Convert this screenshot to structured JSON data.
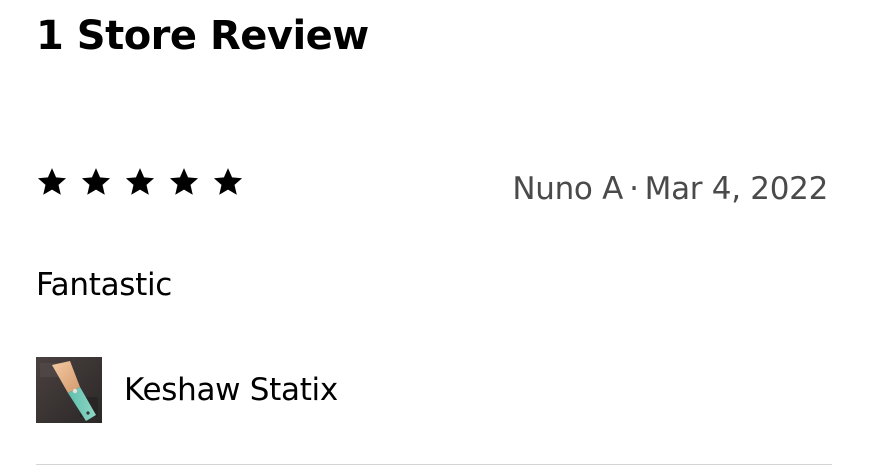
{
  "review_section": {
    "heading": "1 Store Review"
  },
  "review": {
    "rating": 5,
    "max_rating": 5,
    "author": "Nuno A",
    "separator": "·",
    "date": "Mar 4, 2022",
    "title": "Fantastic",
    "product": {
      "name": "Keshaw Statix",
      "thumbnail_icon": "knife-product-thumbnail"
    }
  },
  "colors": {
    "star": "#000000",
    "meta_text": "#4a4a4a",
    "divider": "#d4d4d4"
  }
}
